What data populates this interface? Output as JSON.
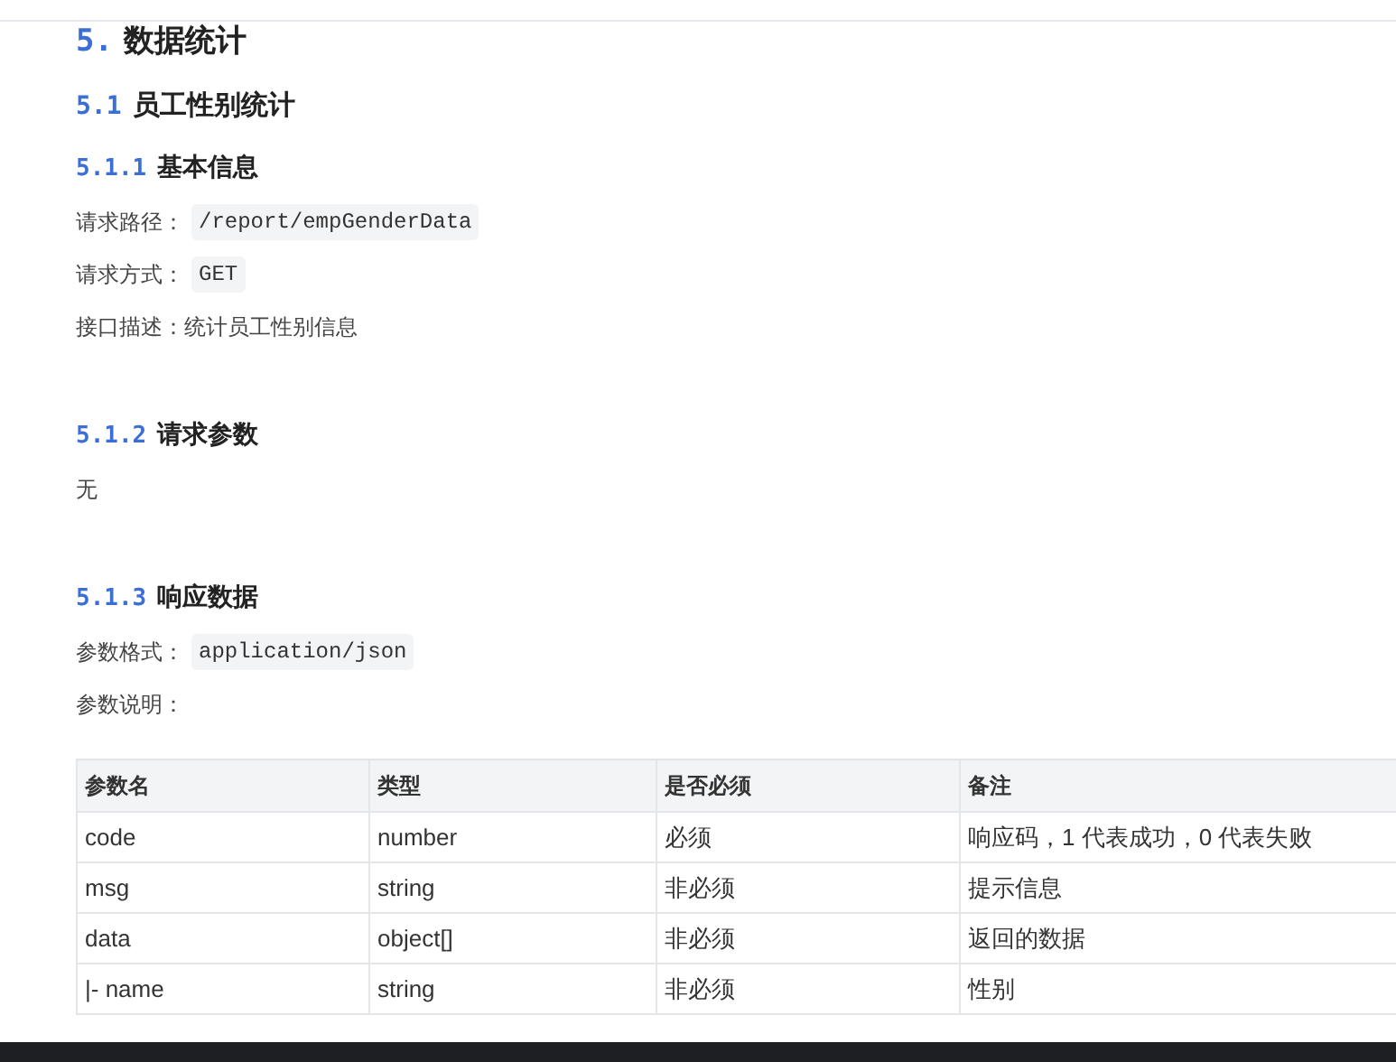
{
  "heading": {
    "number": "5.",
    "title": "数据统计"
  },
  "section": {
    "number": "5.1",
    "title": "员工性别统计"
  },
  "subsections": [
    {
      "number": "5.1.1",
      "title": "基本信息",
      "lines": [
        {
          "label": "请求路径：",
          "code": "/report/empGenderData"
        },
        {
          "label": "请求方式：",
          "code": "GET"
        },
        {
          "label": "接口描述：",
          "text": "统计员工性别信息"
        }
      ]
    },
    {
      "number": "5.1.2",
      "title": "请求参数",
      "lines": [
        {
          "text": "无"
        }
      ]
    },
    {
      "number": "5.1.3",
      "title": "响应数据",
      "lines": [
        {
          "label": "参数格式：",
          "code": "application/json"
        },
        {
          "label": "参数说明："
        }
      ]
    }
  ],
  "table": {
    "columns": [
      "参数名",
      "类型",
      "是否必须",
      "备注"
    ],
    "rows": [
      [
        "code",
        "number",
        "必须",
        "响应码，1 代表成功，0 代表失败"
      ],
      [
        "msg",
        "string",
        "非必须",
        "提示信息"
      ],
      [
        "data",
        "object[]",
        "非必须",
        "返回的数据"
      ],
      [
        "|- name",
        "string",
        "非必须",
        "性别"
      ]
    ]
  }
}
